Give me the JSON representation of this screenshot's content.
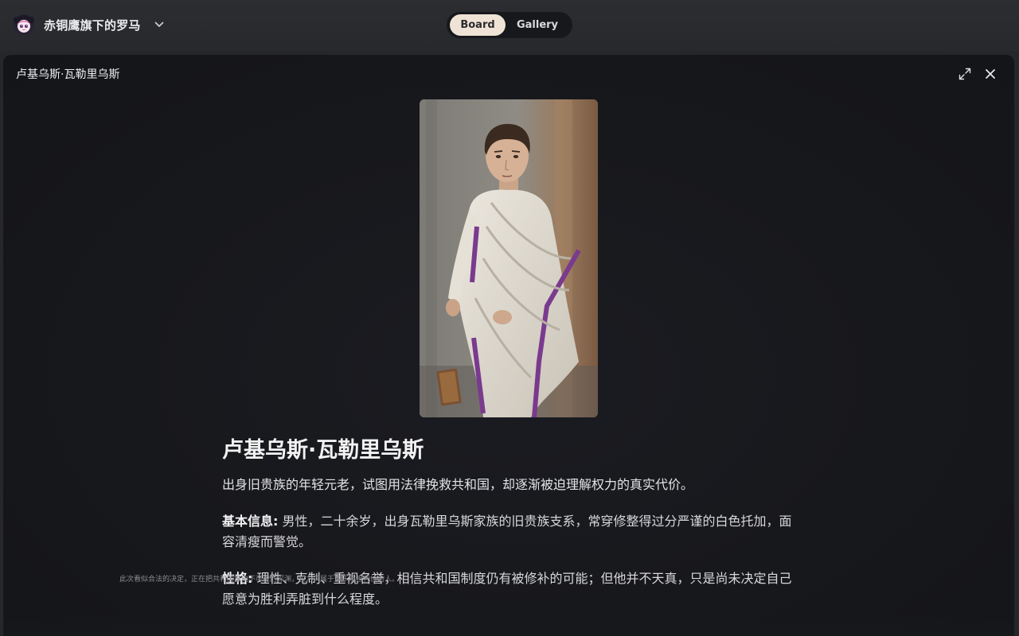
{
  "app": {
    "title": "赤铜鹰旗下的罗马",
    "logo_icon": "anime-avatar-icon",
    "menu_icon": "chevron-down-icon"
  },
  "view_toggle": {
    "options": [
      {
        "label": "Board",
        "active": true
      },
      {
        "label": "Gallery",
        "active": false
      }
    ]
  },
  "modal": {
    "title": "卢基乌斯·瓦勒里乌斯",
    "expand_icon": "expand-icon",
    "close_icon": "close-icon",
    "portrait_icon": "character-portrait-image"
  },
  "character": {
    "name": "卢基乌斯·瓦勒里乌斯",
    "summary": "出身旧贵族的年轻元老，试图用法律挽救共和国，却逐渐被迫理解权力的真实代价。",
    "sections": [
      {
        "label": "基本信息:",
        "text": "男性，二十余岁，出身瓦勒里乌斯家族的旧贵族支系，常穿修整得过分严谨的白色托加，面容清瘦而警觉。"
      },
      {
        "label": "性格:",
        "text": "理性、克制、重视名誉，相信共和国制度仍有被修补的可能；但他并不天真，只是尚未决定自己愿意为胜利弄脏到什么程度。"
      }
    ]
  },
  "ticker": {
    "text": "此次看似合法的决定，正在把共和国推向不可逆的深渊，权力只属于敢于承担代价的人。"
  },
  "colors": {
    "topbar_bg": "#2b2d31",
    "modal_bg": "#17181c",
    "toggle_active_bg": "#efe3d6",
    "toga_purple": "#7a3a8e"
  }
}
